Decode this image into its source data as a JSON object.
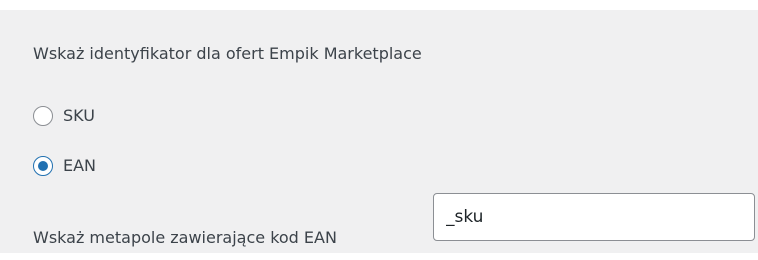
{
  "settings": {
    "heading": "Wskaż identyfikator dla ofert Empik Marketplace",
    "identifier_options": [
      {
        "label": "SKU",
        "checked": false
      },
      {
        "label": "EAN",
        "checked": true
      }
    ],
    "ean_meta_label": "Wskaż metapole zawierające kod EAN",
    "ean_meta_value": "_sku"
  },
  "colors": {
    "panel_background": "#f0f0f1",
    "accent": "#2271b1",
    "text": "#3c434a"
  }
}
